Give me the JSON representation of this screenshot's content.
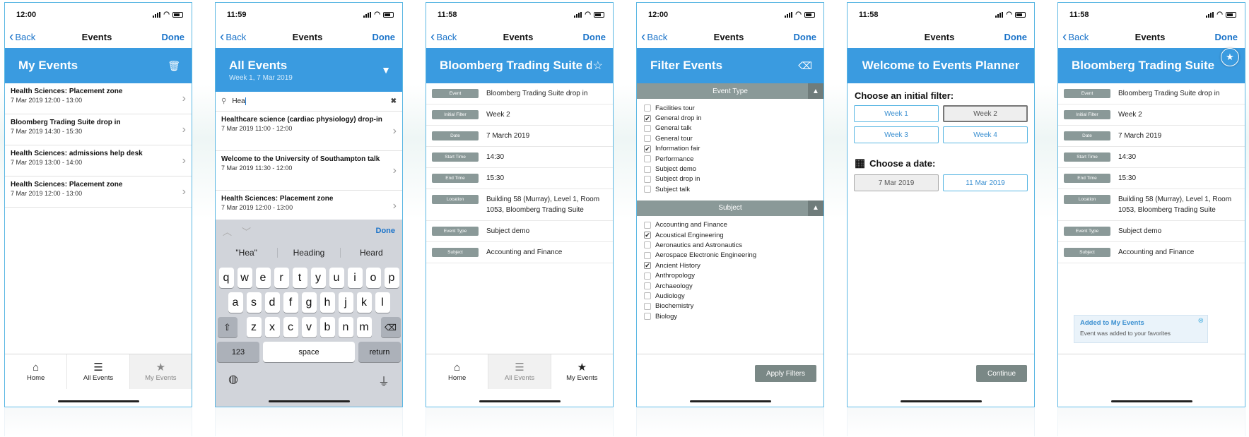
{
  "colors": {
    "primary": "#3a9be0",
    "link": "#1a73c9",
    "label_grey": "#8a9998"
  },
  "nav": {
    "back": "Back",
    "title": "Events",
    "done": "Done"
  },
  "tabs": {
    "home": "Home",
    "all": "All Events",
    "my": "My Events"
  },
  "s1": {
    "time": "12:00",
    "header": "My Events",
    "items": [
      {
        "title": "Health Sciences: Placement zone",
        "date": "7 Mar 2019 12:00 - 13:00"
      },
      {
        "title": "Bloomberg Trading Suite drop in",
        "date": "7 Mar 2019 14:30 - 15:30"
      },
      {
        "title": "Health Sciences: admissions help desk",
        "date": "7 Mar 2019 13:00 - 14:00"
      },
      {
        "title": "Health Sciences: Placement zone",
        "date": "7 Mar 2019 12:00 - 13:00"
      }
    ]
  },
  "s2": {
    "time": "11:59",
    "header": "All Events",
    "subheader": "Week 1, 7 Mar 2019",
    "search": "Hea",
    "items": [
      {
        "title": "Healthcare science (cardiac physiology) drop-in",
        "date": "7 Mar 2019 11:00 - 12:00"
      },
      {
        "title": "Welcome to the University of Southampton talk",
        "date": "7 Mar 2019 11:30 - 12:00"
      },
      {
        "title": "Health Sciences: Placement zone",
        "date": "7 Mar 2019 12:00 - 13:00"
      }
    ],
    "kb": {
      "done": "Done",
      "suggestions": [
        "\"Hea\"",
        "Heading",
        "Heard"
      ],
      "row1": [
        "q",
        "w",
        "e",
        "r",
        "t",
        "y",
        "u",
        "i",
        "o",
        "p"
      ],
      "row2": [
        "a",
        "s",
        "d",
        "f",
        "g",
        "h",
        "j",
        "k",
        "l"
      ],
      "row3": [
        "z",
        "x",
        "c",
        "v",
        "b",
        "n",
        "m"
      ],
      "num": "123",
      "space": "space",
      "ret": "return"
    }
  },
  "s3": {
    "time": "11:58",
    "header": "Bloomberg Trading Suite d"
  },
  "details": [
    {
      "label": "Event",
      "value": "Bloomberg Trading Suite drop in"
    },
    {
      "label": "Initial Filter",
      "value": "Week 2"
    },
    {
      "label": "Date",
      "value": "7 March 2019"
    },
    {
      "label": "Start Time",
      "value": "14:30"
    },
    {
      "label": "End Time",
      "value": "15:30"
    },
    {
      "label": "Location",
      "value": "Building 58 (Murray), Level 1, Room 1053, Bloomberg Trading Suite"
    },
    {
      "label": "Event Type",
      "value": "Subject demo"
    },
    {
      "label": "Subject",
      "value": "Accounting and Finance"
    }
  ],
  "s4": {
    "time": "12:00",
    "header": "Filter Events",
    "section1": "Event Type",
    "types": [
      {
        "label": "Facilities tour",
        "checked": false
      },
      {
        "label": "General drop in",
        "checked": true
      },
      {
        "label": "General talk",
        "checked": false
      },
      {
        "label": "General tour",
        "checked": false
      },
      {
        "label": "Information fair",
        "checked": true
      },
      {
        "label": "Performance",
        "checked": false
      },
      {
        "label": "Subject demo",
        "checked": false
      },
      {
        "label": "Subject drop in",
        "checked": false
      },
      {
        "label": "Subject talk",
        "checked": false
      }
    ],
    "section2": "Subject",
    "subjects": [
      {
        "label": "Accounting and Finance",
        "checked": false
      },
      {
        "label": "Acoustical Engineering",
        "checked": true
      },
      {
        "label": "Aeronautics and Astronautics",
        "checked": false
      },
      {
        "label": "Aerospace Electronic Engineering",
        "checked": false
      },
      {
        "label": "Ancient History",
        "checked": true
      },
      {
        "label": "Anthropology",
        "checked": false
      },
      {
        "label": "Archaeology",
        "checked": false
      },
      {
        "label": "Audiology",
        "checked": false
      },
      {
        "label": "Biochemistry",
        "checked": false
      },
      {
        "label": "Biology",
        "checked": false
      }
    ],
    "apply": "Apply Filters"
  },
  "s5": {
    "time": "11:58",
    "header": "Welcome to Events Planner",
    "filter_title": "Choose an initial filter:",
    "weeks": [
      "Week 1",
      "Week 2",
      "Week 3",
      "Week 4"
    ],
    "date_title": "Choose a date:",
    "dates": [
      "7 Mar 2019",
      "11 Mar 2019"
    ],
    "continue": "Continue"
  },
  "s6": {
    "time": "11:58",
    "header": "Bloomberg Trading Suite d",
    "toast_title": "Added to My Events",
    "toast_msg": "Event was added to your favorites"
  }
}
